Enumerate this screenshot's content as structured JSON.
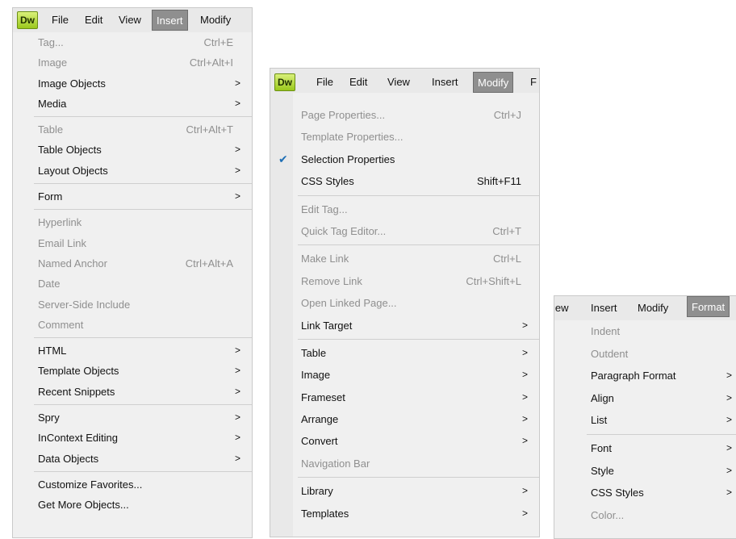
{
  "panel1": {
    "logo": "Dw",
    "menubar": [
      "File",
      "Edit",
      "View",
      "Insert",
      "Modify"
    ],
    "active": "Insert",
    "items": [
      {
        "label": "Tag...",
        "shortcut": "Ctrl+E",
        "arrow": "",
        "disabled": true
      },
      {
        "label": "Image",
        "shortcut": "Ctrl+Alt+I",
        "arrow": "",
        "disabled": true
      },
      {
        "label": "Image Objects",
        "shortcut": "",
        "arrow": ">",
        "disabled": false
      },
      {
        "label": "Media",
        "shortcut": "",
        "arrow": ">",
        "disabled": false
      },
      {
        "sep": true
      },
      {
        "label": "Table",
        "shortcut": "Ctrl+Alt+T",
        "arrow": "",
        "disabled": true
      },
      {
        "label": "Table Objects",
        "shortcut": "",
        "arrow": ">",
        "disabled": false
      },
      {
        "label": "Layout Objects",
        "shortcut": "",
        "arrow": ">",
        "disabled": false
      },
      {
        "sep": true
      },
      {
        "label": "Form",
        "shortcut": "",
        "arrow": ">",
        "disabled": false
      },
      {
        "sep": true
      },
      {
        "label": "Hyperlink",
        "shortcut": "",
        "arrow": "",
        "disabled": true
      },
      {
        "label": "Email Link",
        "shortcut": "",
        "arrow": "",
        "disabled": true
      },
      {
        "label": "Named Anchor",
        "shortcut": "Ctrl+Alt+A",
        "arrow": "",
        "disabled": true
      },
      {
        "label": "Date",
        "shortcut": "",
        "arrow": "",
        "disabled": true
      },
      {
        "label": "Server-Side Include",
        "shortcut": "",
        "arrow": "",
        "disabled": true
      },
      {
        "label": "Comment",
        "shortcut": "",
        "arrow": "",
        "disabled": true
      },
      {
        "sep": true
      },
      {
        "label": "HTML",
        "shortcut": "",
        "arrow": ">",
        "disabled": false
      },
      {
        "label": "Template Objects",
        "shortcut": "",
        "arrow": ">",
        "disabled": false
      },
      {
        "label": "Recent Snippets",
        "shortcut": "",
        "arrow": ">",
        "disabled": false
      },
      {
        "sep": true
      },
      {
        "label": "Spry",
        "shortcut": "",
        "arrow": ">",
        "disabled": false
      },
      {
        "label": "InContext Editing",
        "shortcut": "",
        "arrow": ">",
        "disabled": false
      },
      {
        "label": "Data Objects",
        "shortcut": "",
        "arrow": ">",
        "disabled": false
      },
      {
        "sep": true
      },
      {
        "label": "Customize Favorites...",
        "shortcut": "",
        "arrow": "",
        "disabled": false
      },
      {
        "label": "Get More Objects...",
        "shortcut": "",
        "arrow": "",
        "disabled": false
      }
    ]
  },
  "panel2": {
    "logo": "Dw",
    "menubar": [
      "File",
      "Edit",
      "View",
      "Insert",
      "Modify",
      "F"
    ],
    "active": "Modify",
    "items": [
      {
        "label": "Page Properties...",
        "shortcut": "Ctrl+J",
        "arrow": "",
        "disabled": true
      },
      {
        "label": "Template Properties...",
        "shortcut": "",
        "arrow": "",
        "disabled": true
      },
      {
        "label": "Selection Properties",
        "shortcut": "",
        "arrow": "",
        "disabled": false,
        "checked": true
      },
      {
        "label": "CSS Styles",
        "shortcut": "Shift+F11",
        "arrow": "",
        "disabled": false
      },
      {
        "sep": true
      },
      {
        "label": "Edit Tag...",
        "shortcut": "",
        "arrow": "",
        "disabled": true
      },
      {
        "label": "Quick Tag Editor...",
        "shortcut": "Ctrl+T",
        "arrow": "",
        "disabled": true
      },
      {
        "sep": true
      },
      {
        "label": "Make Link",
        "shortcut": "Ctrl+L",
        "arrow": "",
        "disabled": true
      },
      {
        "label": "Remove Link",
        "shortcut": "Ctrl+Shift+L",
        "arrow": "",
        "disabled": true
      },
      {
        "label": "Open Linked Page...",
        "shortcut": "",
        "arrow": "",
        "disabled": true
      },
      {
        "label": "Link Target",
        "shortcut": "",
        "arrow": ">",
        "disabled": false
      },
      {
        "sep": true
      },
      {
        "label": "Table",
        "shortcut": "",
        "arrow": ">",
        "disabled": false
      },
      {
        "label": "Image",
        "shortcut": "",
        "arrow": ">",
        "disabled": false
      },
      {
        "label": "Frameset",
        "shortcut": "",
        "arrow": ">",
        "disabled": false
      },
      {
        "label": "Arrange",
        "shortcut": "",
        "arrow": ">",
        "disabled": false
      },
      {
        "label": "Convert",
        "shortcut": "",
        "arrow": ">",
        "disabled": false
      },
      {
        "label": "Navigation Bar",
        "shortcut": "",
        "arrow": "",
        "disabled": true
      },
      {
        "sep": true
      },
      {
        "label": "Library",
        "shortcut": "",
        "arrow": ">",
        "disabled": false
      },
      {
        "label": "Templates",
        "shortcut": "",
        "arrow": ">",
        "disabled": false
      }
    ]
  },
  "panel3": {
    "menubar": [
      "iew",
      "Insert",
      "Modify",
      "Format"
    ],
    "active": "Format",
    "items": [
      {
        "label": "Indent",
        "shortcut": "",
        "arrow": "",
        "disabled": true
      },
      {
        "label": "Outdent",
        "shortcut": "",
        "arrow": "",
        "disabled": true
      },
      {
        "label": "Paragraph Format",
        "shortcut": "",
        "arrow": ">",
        "disabled": false
      },
      {
        "label": "Align",
        "shortcut": "",
        "arrow": ">",
        "disabled": false
      },
      {
        "label": "List",
        "shortcut": "",
        "arrow": ">",
        "disabled": false
      },
      {
        "sep": true
      },
      {
        "label": "Font",
        "shortcut": "",
        "arrow": ">",
        "disabled": false
      },
      {
        "label": "Style",
        "shortcut": "",
        "arrow": ">",
        "disabled": false
      },
      {
        "label": "CSS Styles",
        "shortcut": "",
        "arrow": ">",
        "disabled": false
      },
      {
        "label": "Color...",
        "shortcut": "",
        "arrow": "",
        "disabled": true
      }
    ]
  }
}
